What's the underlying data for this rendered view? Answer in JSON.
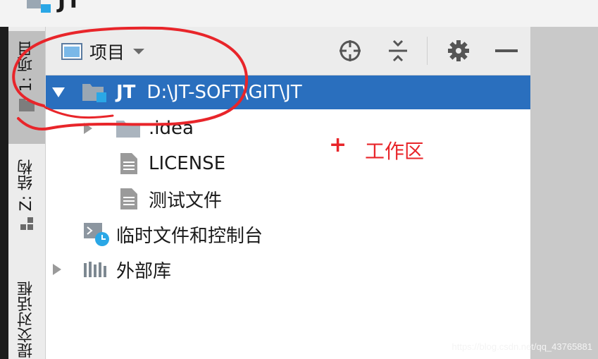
{
  "window": {
    "title": "JT"
  },
  "sidebar": {
    "tabs": [
      {
        "label": "1: 项目",
        "icon": "folder-icon",
        "active": true
      },
      {
        "label": "Z: 结构",
        "icon": "structure-icon",
        "active": false
      },
      {
        "label": "提交对话框",
        "icon": "",
        "active": false
      }
    ]
  },
  "project_panel": {
    "view_label": "项目",
    "toolbar": [
      {
        "icon": "locate-target-icon"
      },
      {
        "icon": "collapse-all-icon"
      },
      {
        "icon": "gear-icon"
      },
      {
        "icon": "minimize-icon"
      }
    ],
    "tree": [
      {
        "name": "JT",
        "path": "D:\\JT-SOFT\\GIT\\JT",
        "icon": "module-folder-icon",
        "expanded": true,
        "selected": true
      },
      {
        "name": ".idea",
        "icon": "folder-icon",
        "expanded": false
      },
      {
        "name": "LICENSE",
        "icon": "text-file-icon"
      },
      {
        "name": "测试文件",
        "icon": "text-file-icon"
      },
      {
        "name": "临时文件和控制台",
        "icon": "scratches-icon"
      },
      {
        "name": "外部库",
        "icon": "library-icon",
        "expanded": false
      }
    ]
  },
  "annotation": {
    "plus": "+",
    "label": "工作区",
    "color": "#e8252a"
  },
  "watermark": "https://blog.csdn.net/qq_43765881",
  "colors": {
    "selection": "#2a6fbe",
    "annotation_red": "#e8252a",
    "folder": "#9aa7b3",
    "module_accent": "#2aa7e6"
  }
}
